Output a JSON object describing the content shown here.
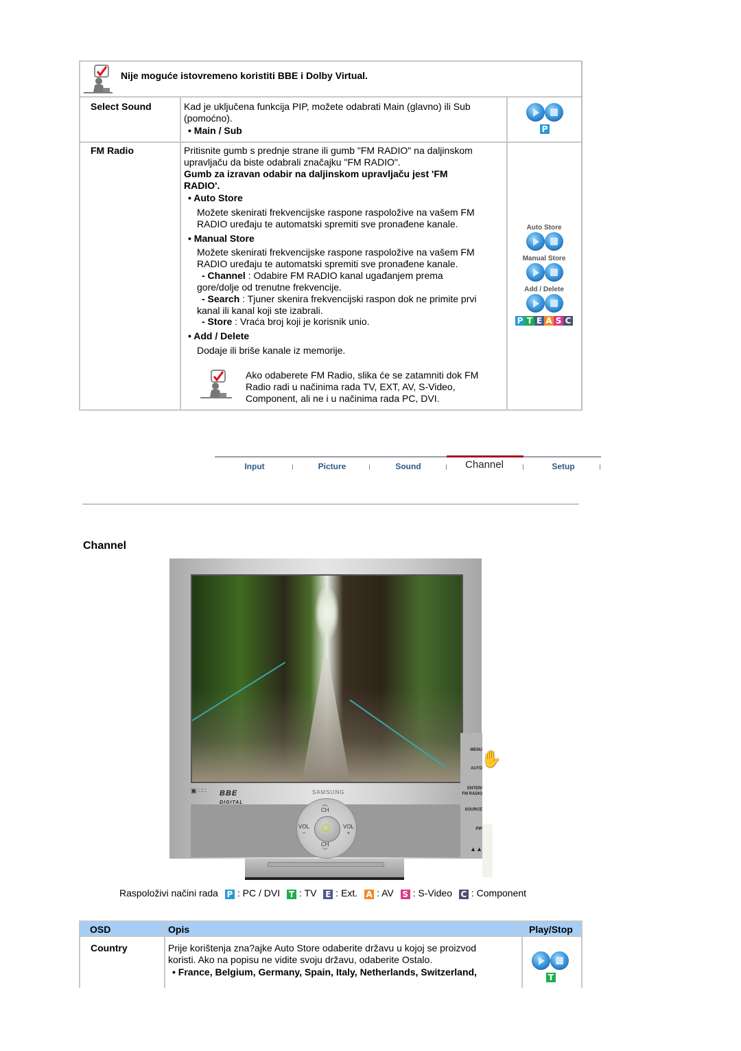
{
  "top_note": {
    "icon": "note-check-icon",
    "text": "Nije moguće istovremeno koristiti BBE i Dolby Virtual."
  },
  "rows": [
    {
      "label": "Select Sound",
      "desc_lines": [
        "Kad je uključena funkcija PIP, možete odabrati Main (glavno) ili Sub",
        "(pomoćno)."
      ],
      "bullet": "• Main / Sub",
      "mode_badges": [
        "P"
      ]
    },
    {
      "label": "FM Radio",
      "desc_lines": [
        "Pritisnite gumb s prednje strane ili gumb \"FM RADIO\" na daljinskom",
        "upravljaču da biste odabrali značajku \"FM RADIO\"."
      ],
      "bold_lines": [
        "Gumb za izravan odabir na daljinskom upravljaču jest 'FM",
        "RADIO'."
      ],
      "auto_store": {
        "title": "• Auto Store",
        "lines": [
          "Možete skenirati frekvencijske raspone raspoložive na vašem FM",
          "RADIO uređaju te automatski spremiti sve pronađene kanale."
        ]
      },
      "manual_store": {
        "title": "• Manual Store",
        "lines": [
          "Možete skenirati frekvencijske raspone raspoložive na vašem FM",
          "RADIO uređaju te automatski spremiti sve pronađene kanale."
        ],
        "sub": [
          {
            "key": "- Channel",
            "text": " : Odabire FM RADIO kanal ugađanjem prema",
            "cont": "gore/dolje od trenutne frekvencije."
          },
          {
            "key": "- Search",
            "text": " : Tjuner skenira frekvencijski raspon dok ne primite prvi",
            "cont": "kanal ili kanal koji ste izabrali."
          },
          {
            "key": "- Store",
            "text": " : Vraća broj koji je korisnik unio.",
            "cont": ""
          }
        ]
      },
      "add_delete": {
        "title": "• Add / Delete",
        "lines": [
          "Dodaje ili briše kanale iz memorije."
        ]
      },
      "note_lines": [
        "Ako odaberete FM Radio, slika će se zatamniti dok FM",
        "Radio radi u načinima rada TV, EXT, AV, S-Video,",
        "Component, ali ne i u načinima rada PC, DVI."
      ],
      "side_labels": [
        "Auto Store",
        "Manual Store",
        "Add / Delete"
      ],
      "mode_badges": [
        "P",
        "T",
        "E",
        "A",
        "S",
        "C"
      ]
    }
  ],
  "nav": {
    "items": [
      "Input",
      "Picture",
      "Sound",
      "Channel",
      "Setup"
    ],
    "active": "Channel"
  },
  "section_title": "Channel",
  "monitor": {
    "side_buttons": [
      "MENU",
      "AUTO",
      "ENTER/",
      "FM RADIO",
      "SOURCE",
      "PIP"
    ],
    "dial": {
      "top": "CH",
      "bottom": "CH",
      "left": "VOL",
      "left_sign": "−",
      "right": "VOL",
      "right_sign": "+"
    },
    "logos": {
      "bbe": "BBE",
      "bbe_sub": "DIGITAL",
      "brand": "SAMSUNG"
    }
  },
  "modes": {
    "prefix": "Raspoloživi načini rada",
    "items": [
      {
        "badge": "P",
        "label": ": PC / DVI",
        "color": "#2a9ad6"
      },
      {
        "badge": "T",
        "label": ": TV",
        "color": "#1fae4b"
      },
      {
        "badge": "E",
        "label": ": Ext.",
        "color": "#4a5a8a"
      },
      {
        "badge": "A",
        "label": ": AV",
        "color": "#f08a2a"
      },
      {
        "badge": "S",
        "label": ": S-Video",
        "color": "#d93a8a"
      },
      {
        "badge": "C",
        "label": ": Component",
        "color": "#4a5070"
      }
    ]
  },
  "bottom_table": {
    "headers": [
      "OSD",
      "Opis",
      "Play/Stop"
    ],
    "header_color": "#a6cdf6",
    "rows": [
      {
        "label": "Country",
        "desc_lines": [
          "Prije korištenja zna?ajke Auto Store odaberite državu u kojoj se proizvod",
          "koristi. Ako na popisu ne vidite svoju državu, odaberite Ostalo."
        ],
        "bullet": "• France, Belgium, Germany, Spain, Italy, Netherlands, Switzerland,",
        "mode_badges": [
          "T"
        ]
      }
    ]
  },
  "colors": {
    "P": "#2a9ad6",
    "T": "#1fae4b",
    "E": "#4a5a8a",
    "A": "#f08a2a",
    "S": "#d93a8a",
    "C": "#4a5070",
    "nav_active": "#a21620",
    "nav_text": "#2c5a86"
  }
}
